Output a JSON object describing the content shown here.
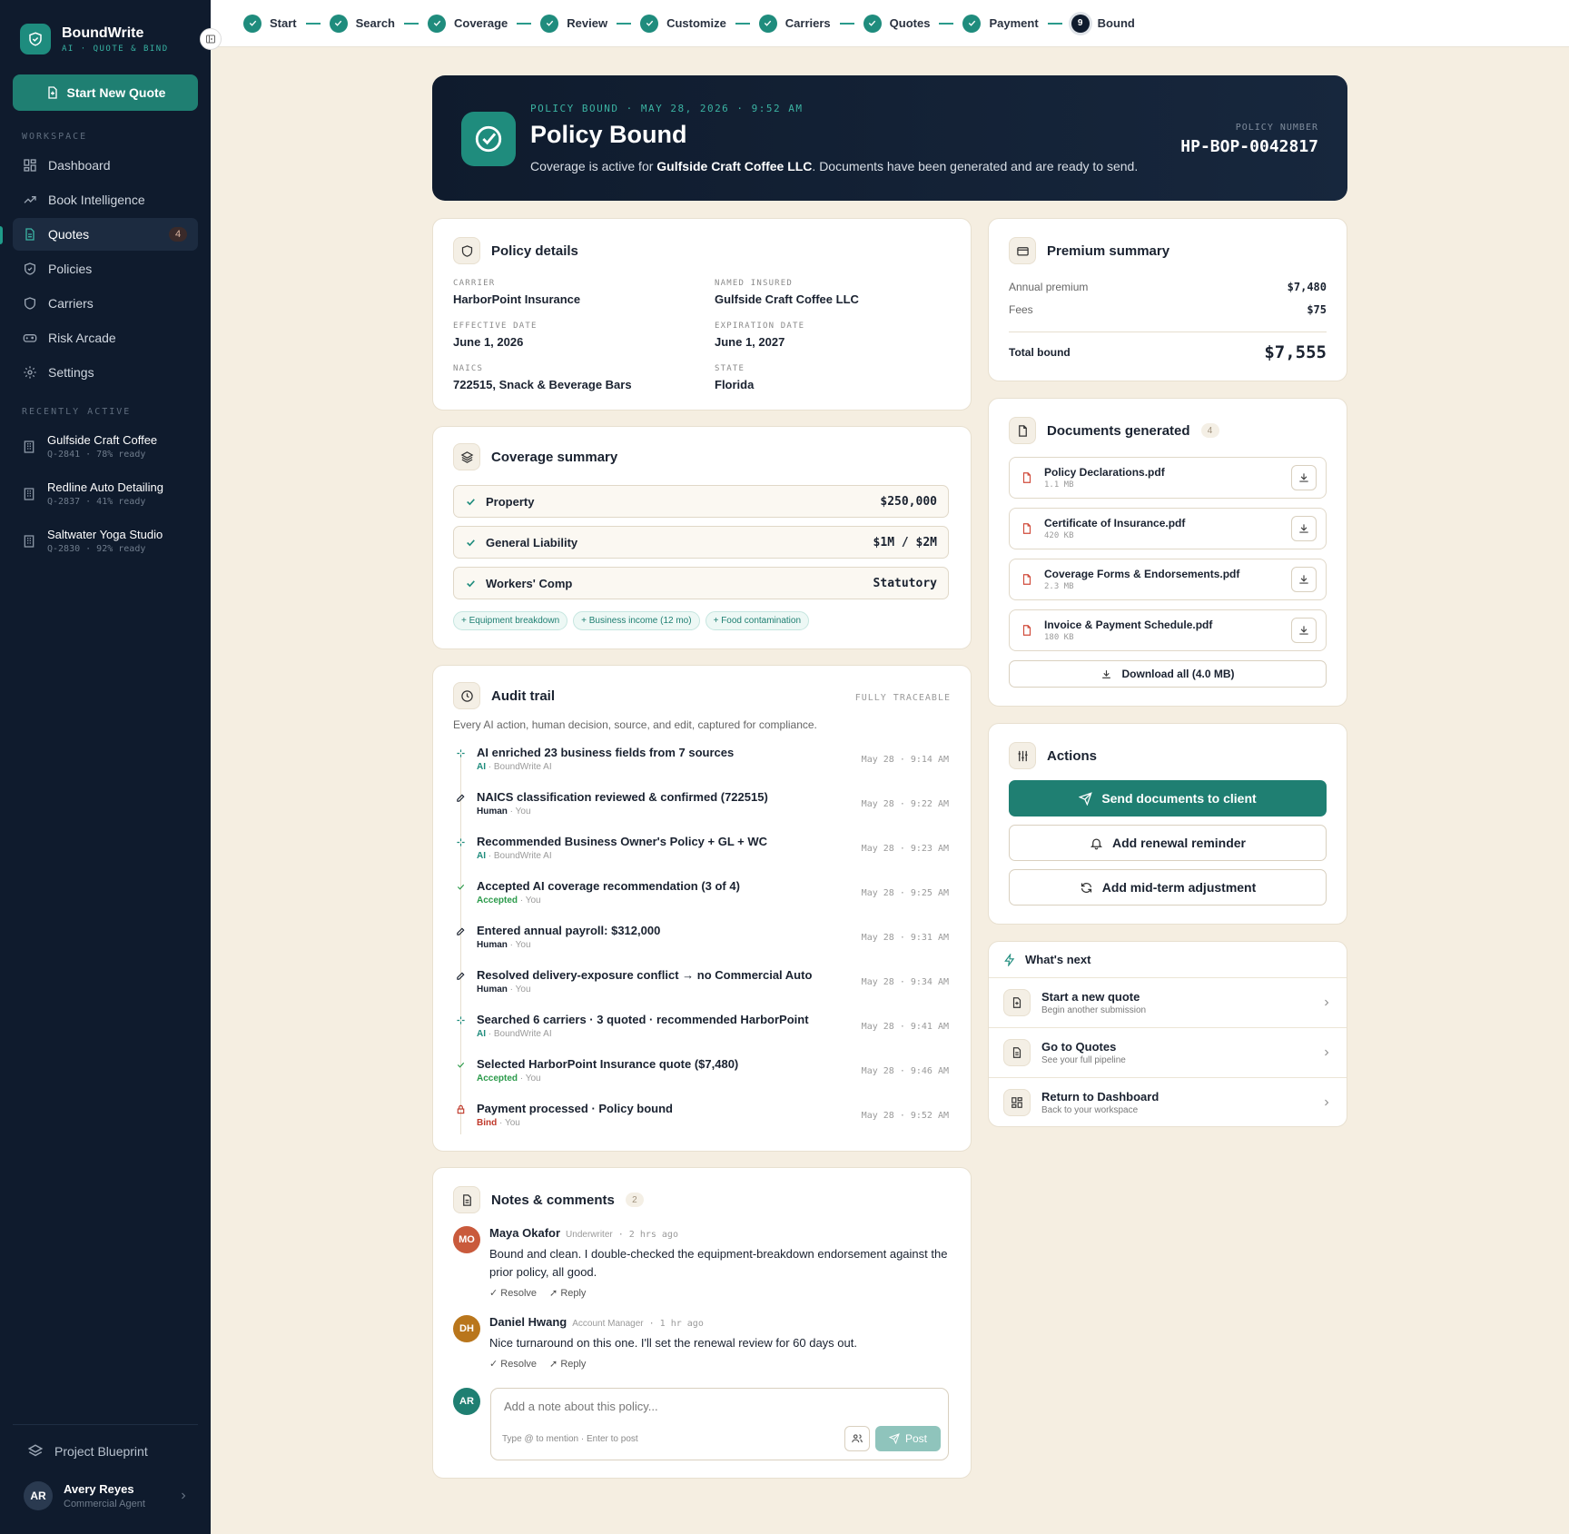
{
  "app": {
    "name": "BoundWrite",
    "tagline": "AI · QUOTE & BIND",
    "new_quote": "Start New Quote"
  },
  "sidebar": {
    "workspace_label": "WORKSPACE",
    "items": [
      {
        "label": "Dashboard",
        "icon": "grid-icon"
      },
      {
        "label": "Book Intelligence",
        "icon": "trend-icon"
      },
      {
        "label": "Quotes",
        "icon": "document-icon",
        "badge": "4"
      },
      {
        "label": "Policies",
        "icon": "shield-icon"
      },
      {
        "label": "Carriers",
        "icon": "shield-icon"
      },
      {
        "label": "Risk Arcade",
        "icon": "gamepad-icon"
      },
      {
        "label": "Settings",
        "icon": "gear-icon"
      }
    ],
    "recent_label": "RECENTLY ACTIVE",
    "recent": [
      {
        "name": "Gulfside Craft Coffee",
        "meta": "Q-2841 · 78% ready"
      },
      {
        "name": "Redline Auto Detailing",
        "meta": "Q-2837 · 41% ready"
      },
      {
        "name": "Saltwater Yoga Studio",
        "meta": "Q-2830 · 92% ready"
      }
    ],
    "blueprint": "Project Blueprint",
    "user": {
      "initials": "AR",
      "name": "Avery Reyes",
      "role": "Commercial Agent"
    }
  },
  "steps": [
    {
      "label": "Start"
    },
    {
      "label": "Search"
    },
    {
      "label": "Coverage"
    },
    {
      "label": "Review"
    },
    {
      "label": "Customize"
    },
    {
      "label": "Carriers"
    },
    {
      "label": "Quotes"
    },
    {
      "label": "Payment"
    },
    {
      "label": "Bound",
      "num": "9"
    }
  ],
  "hero": {
    "kicker": "POLICY BOUND · MAY 28, 2026 · 9:52 AM",
    "title": "Policy Bound",
    "desc_pre": "Coverage is active for ",
    "desc_bold": "Gulfside Craft Coffee LLC",
    "desc_post": ". Documents have been generated and are ready to send.",
    "policy_label": "POLICY NUMBER",
    "policy_number": "HP-BOP-0042817"
  },
  "policy": {
    "title": "Policy details",
    "fields": [
      {
        "label": "CARRIER",
        "value": "HarborPoint Insurance"
      },
      {
        "label": "NAMED INSURED",
        "value": "Gulfside Craft Coffee LLC"
      },
      {
        "label": "EFFECTIVE DATE",
        "value": "June 1, 2026"
      },
      {
        "label": "EXPIRATION DATE",
        "value": "June 1, 2027"
      },
      {
        "label": "NAICS",
        "value": "722515, Snack & Beverage Bars"
      },
      {
        "label": "STATE",
        "value": "Florida"
      }
    ]
  },
  "coverage": {
    "title": "Coverage summary",
    "items": [
      {
        "name": "Property",
        "value": "$250,000"
      },
      {
        "name": "General Liability",
        "value": "$1M / $2M"
      },
      {
        "name": "Workers' Comp",
        "value": "Statutory"
      }
    ],
    "chips": [
      "+ Equipment breakdown",
      "+ Business income (12 mo)",
      "+ Food contamination"
    ]
  },
  "audit": {
    "title": "Audit trail",
    "tag": "FULLY TRACEABLE",
    "desc": "Every AI action, human decision, source, and edit, captured for compliance.",
    "entries": [
      {
        "text": "AI enriched 23 business fields from 7 sources",
        "kind": "AI",
        "who": "BoundWrite AI",
        "time": "May 28 · 9:14 AM"
      },
      {
        "text": "NAICS classification reviewed & confirmed (722515)",
        "kind": "Human",
        "who": "You",
        "time": "May 28 · 9:22 AM"
      },
      {
        "text": "Recommended Business Owner's Policy + GL + WC",
        "kind": "AI",
        "who": "BoundWrite AI",
        "time": "May 28 · 9:23 AM"
      },
      {
        "text": "Accepted AI coverage recommendation (3 of 4)",
        "kind": "Accepted",
        "who": "You",
        "time": "May 28 · 9:25 AM"
      },
      {
        "text": "Entered annual payroll: $312,000",
        "kind": "Human",
        "who": "You",
        "time": "May 28 · 9:31 AM"
      },
      {
        "text": "Resolved delivery-exposure conflict → no Commercial Auto",
        "kind": "Human",
        "who": "You",
        "time": "May 28 · 9:34 AM"
      },
      {
        "text": "Searched 6 carriers · 3 quoted · recommended HarborPoint",
        "kind": "AI",
        "who": "BoundWrite AI",
        "time": "May 28 · 9:41 AM"
      },
      {
        "text": "Selected HarborPoint Insurance quote ($7,480)",
        "kind": "Accepted",
        "who": "You",
        "time": "May 28 · 9:46 AM"
      },
      {
        "text": "Payment processed · Policy bound",
        "kind": "Bind",
        "who": "You",
        "time": "May 28 · 9:52 AM"
      }
    ]
  },
  "notes": {
    "title": "Notes & comments",
    "count": "2",
    "items": [
      {
        "initials": "MO",
        "name": "Maya Okafor",
        "role": "Underwriter",
        "time": "· 2 hrs ago",
        "text": "Bound and clean. I double-checked the equipment-breakdown endorsement against the prior policy, all good."
      },
      {
        "initials": "DH",
        "name": "Daniel Hwang",
        "role": "Account Manager",
        "time": "· 1 hr ago",
        "text": "Nice turnaround on this one. I'll set the renewal review for 60 days out."
      }
    ],
    "resolve": "Resolve",
    "reply": "Reply",
    "me": "AR",
    "placeholder": "Add a note about this policy...",
    "hint": "Type @ to mention · Enter to post",
    "post": "Post"
  },
  "premium": {
    "title": "Premium summary",
    "rows": [
      {
        "label": "Annual premium",
        "value": "$7,480"
      },
      {
        "label": "Fees",
        "value": "$75"
      }
    ],
    "total_label": "Total bound",
    "total": "$7,555"
  },
  "documents": {
    "title": "Documents generated",
    "count": "4",
    "files": [
      {
        "name": "Policy Declarations.pdf",
        "size": "1.1 MB"
      },
      {
        "name": "Certificate of Insurance.pdf",
        "size": "420 KB"
      },
      {
        "name": "Coverage Forms & Endorsements.pdf",
        "size": "2.3 MB"
      },
      {
        "name": "Invoice & Payment Schedule.pdf",
        "size": "180 KB"
      }
    ],
    "download_all": "Download all (4.0 MB)"
  },
  "actions": {
    "title": "Actions",
    "send": "Send documents to client",
    "reminder": "Add renewal reminder",
    "adjust": "Add mid-term adjustment"
  },
  "whats_next": {
    "title": "What's next",
    "items": [
      {
        "title": "Start a new quote",
        "sub": "Begin another submission"
      },
      {
        "title": "Go to Quotes",
        "sub": "See your full pipeline"
      },
      {
        "title": "Return to Dashboard",
        "sub": "Back to your workspace"
      }
    ]
  },
  "colors": {
    "accent": "#1f7f72",
    "navy": "#0f1b2d",
    "background": "#f5eee1",
    "ai": "#1f8c7d",
    "human": "#1a2230",
    "accepted": "#2a9a4a",
    "bind": "#c0392b"
  }
}
